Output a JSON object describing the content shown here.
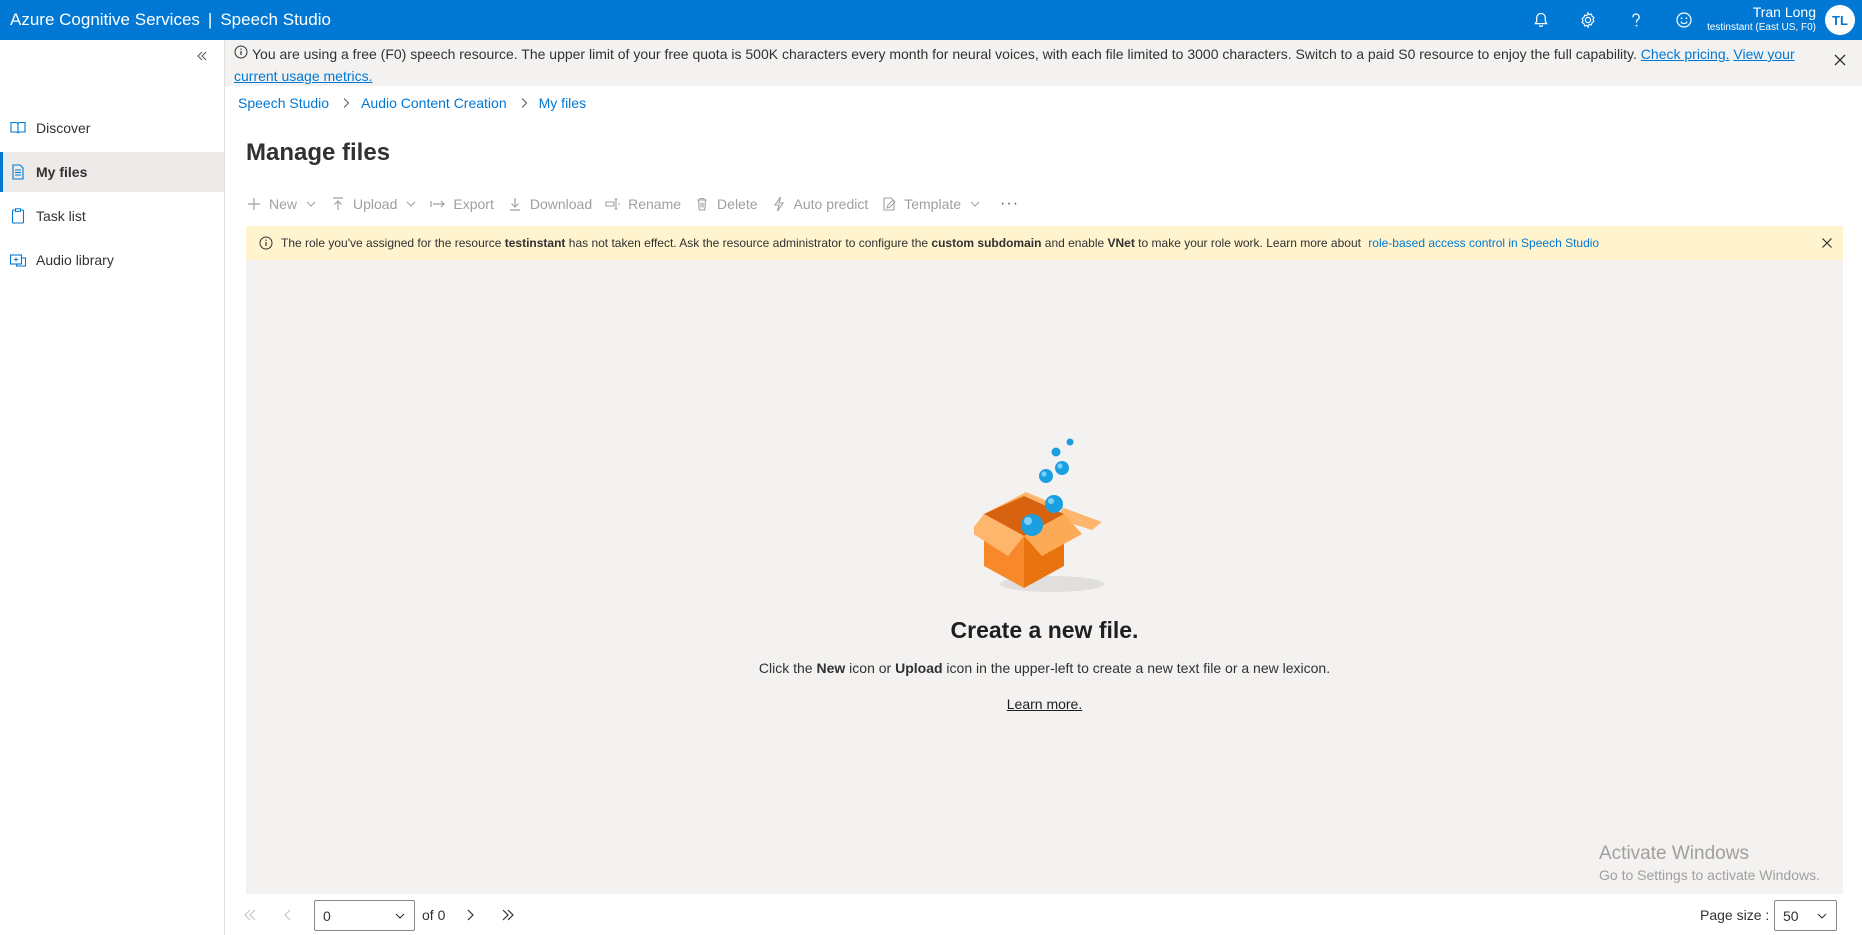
{
  "header": {
    "brand_left": "Azure Cognitive Services",
    "brand_sep": "|",
    "brand_right": "Speech Studio",
    "user_name": "Tran Long",
    "user_resource": "testinstant (East US, F0)",
    "avatar_initials": "TL",
    "icons": [
      "bell-icon",
      "gear-icon",
      "help-icon",
      "feedback-smiley-icon"
    ],
    "color": "#0078d4"
  },
  "sidebar": {
    "items": [
      {
        "label": "Discover",
        "icon": "book-icon"
      },
      {
        "label": "My files",
        "icon": "document-icon",
        "active": true
      },
      {
        "label": "Task list",
        "icon": "clipboard-icon"
      },
      {
        "label": "Audio library",
        "icon": "audio-library-icon"
      }
    ]
  },
  "info_banner": {
    "text": "You are using a free (F0) speech resource. The upper limit of your free quota is 500K characters every month for neural voices, with each file limited to 3000 characters. Switch to a paid S0 resource to enjoy the full capability.",
    "link1": "Check pricing.",
    "link2": "View your current usage metrics."
  },
  "breadcrumb": [
    "Speech Studio",
    "Audio Content Creation",
    "My files"
  ],
  "page_title": "Manage files",
  "toolbar": {
    "new": "New",
    "upload": "Upload",
    "export": "Export",
    "download": "Download",
    "rename": "Rename",
    "delete": "Delete",
    "auto_predict": "Auto predict",
    "template": "Template",
    "more": "···"
  },
  "warning": {
    "p1": "The role you've assigned for the resource ",
    "b1": "testinstant",
    "p2": " has not taken effect. Ask the resource administrator to configure the ",
    "b2": "custom subdomain",
    "p3": " and enable ",
    "b3": "VNet",
    "p4": " to make your role work. Learn more about ",
    "link": "role-based access control in Speech Studio",
    "color": "#fff4ce"
  },
  "empty_state": {
    "title": "Create a new file.",
    "desc_p1": "Click the ",
    "desc_b1": "New",
    "desc_p2": " icon or ",
    "desc_b2": "Upload",
    "desc_p3": " icon in the upper-left to create a new text file or a new lexicon.",
    "learn_more": "Learn more."
  },
  "watermark": {
    "line1": "Activate Windows",
    "line2": "Go to Settings to activate Windows."
  },
  "pagination": {
    "current_page": "0",
    "of_text": "of 0",
    "page_size_label": "Page size :",
    "page_size": "50"
  }
}
